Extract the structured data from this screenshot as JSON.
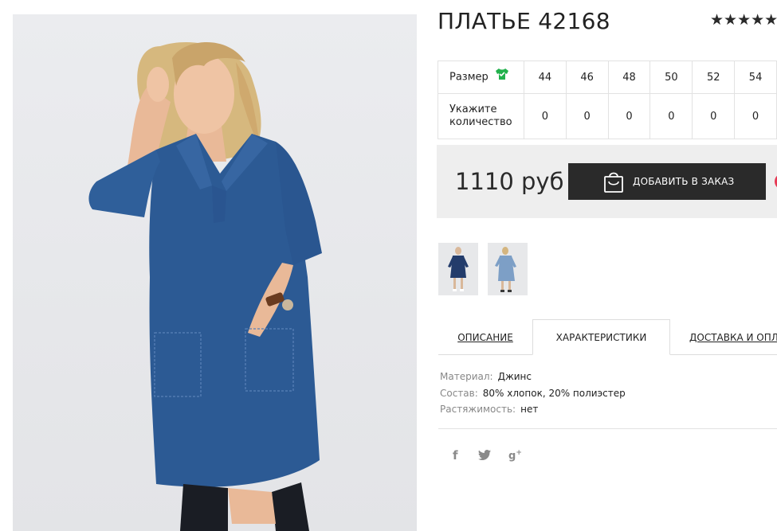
{
  "product": {
    "title": "ПЛАТЬЕ 42168",
    "rating_stars": "★★★★★",
    "rating_value": 5
  },
  "sizes": {
    "size_label": "Размер",
    "qty_label": "Укажите количество",
    "values": [
      "44",
      "46",
      "48",
      "50",
      "52",
      "54"
    ],
    "quantities": [
      "0",
      "0",
      "0",
      "0",
      "0",
      "0"
    ]
  },
  "order": {
    "price": "1110 руб",
    "add_button_label": "ДОБАВИТЬ В ЗАКАЗ"
  },
  "tabs": {
    "description": "ОПИСАНИЕ",
    "characteristics": "ХАРАКТЕРИСТИКИ",
    "delivery": "ДОСТАВКА И ОПЛАТА",
    "active": "characteristics"
  },
  "characteristics": [
    {
      "key": "Материал:",
      "value": "Джинс"
    },
    {
      "key": "Состав:",
      "value": "80% хлопок, 20% полиэстер"
    },
    {
      "key": "Растяжимость:",
      "value": "нет"
    }
  ],
  "social": {
    "facebook_glyph": "f",
    "twitter_glyph": "t",
    "google_plus_glyph": "g",
    "google_plus_sup": "+"
  },
  "colors": {
    "dress": "#2c5a94",
    "button": "#2a2a2a",
    "size_icon": "#22b14c",
    "order_box_bg": "#eeeeee"
  }
}
